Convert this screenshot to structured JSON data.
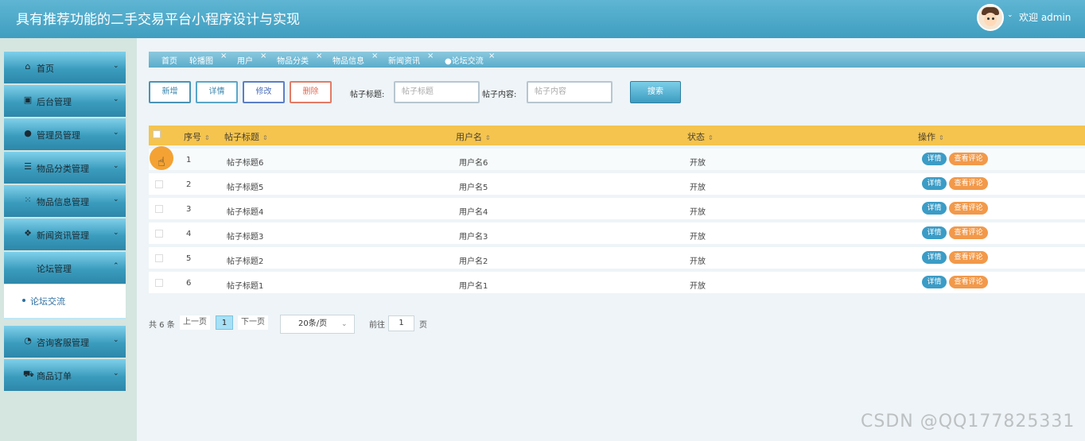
{
  "app": {
    "title": "具有推荐功能的二手交易平台小程序设计与实现",
    "welcome": "欢迎 admin"
  },
  "sidebar": {
    "items": [
      {
        "label": "首页",
        "icon": "home-icon"
      },
      {
        "label": "后台管理",
        "icon": "chip-icon"
      },
      {
        "label": "管理员管理",
        "icon": "circle-icon"
      },
      {
        "label": "物品分类管理",
        "icon": "server-icon"
      },
      {
        "label": "物品信息管理",
        "icon": "grid-icon"
      },
      {
        "label": "新闻资讯管理",
        "icon": "apps-icon"
      },
      {
        "label": "论坛管理",
        "icon": ""
      },
      {
        "label": "咨询客服管理",
        "icon": "gauge-icon"
      },
      {
        "label": "商品订单",
        "icon": "car-icon"
      }
    ],
    "sub_item": "论坛交流"
  },
  "tabs": [
    "首页",
    "轮播图",
    "用户",
    "物品分类",
    "物品信息",
    "新闻资讯",
    "论坛交流"
  ],
  "toolbar": {
    "add": "新增",
    "detail": "详情",
    "edit": "修改",
    "delete": "删除",
    "title_label": "帖子标题:",
    "title_placeholder": "帖子标题",
    "content_label": "帖子内容:",
    "content_placeholder": "帖子内容",
    "search": "搜索"
  },
  "table": {
    "headers": [
      "序号",
      "帖子标题",
      "用户名",
      "状态",
      "操作"
    ],
    "rows": [
      {
        "index": "1",
        "title": "帖子标题6",
        "user": "用户名6",
        "status": "开放"
      },
      {
        "index": "2",
        "title": "帖子标题5",
        "user": "用户名5",
        "status": "开放"
      },
      {
        "index": "3",
        "title": "帖子标题4",
        "user": "用户名4",
        "status": "开放"
      },
      {
        "index": "4",
        "title": "帖子标题3",
        "user": "用户名3",
        "status": "开放"
      },
      {
        "index": "5",
        "title": "帖子标题2",
        "user": "用户名2",
        "status": "开放"
      },
      {
        "index": "6",
        "title": "帖子标题1",
        "user": "用户名1",
        "status": "开放"
      }
    ],
    "action_detail": "详情",
    "action_comment": "查看评论"
  },
  "pagination": {
    "total": "共 6 条",
    "prev": "上一页",
    "page": "1",
    "next": "下一页",
    "page_size": "20条/页",
    "goto": "前往",
    "goto_value": "1",
    "page_unit": "页"
  },
  "watermark": "CSDN @QQ177825331",
  "colors": {
    "header": "#3f9ec0",
    "table_header": "#f4c44e",
    "accent": "#3b9cc6",
    "comment_tag": "#f2994a"
  }
}
